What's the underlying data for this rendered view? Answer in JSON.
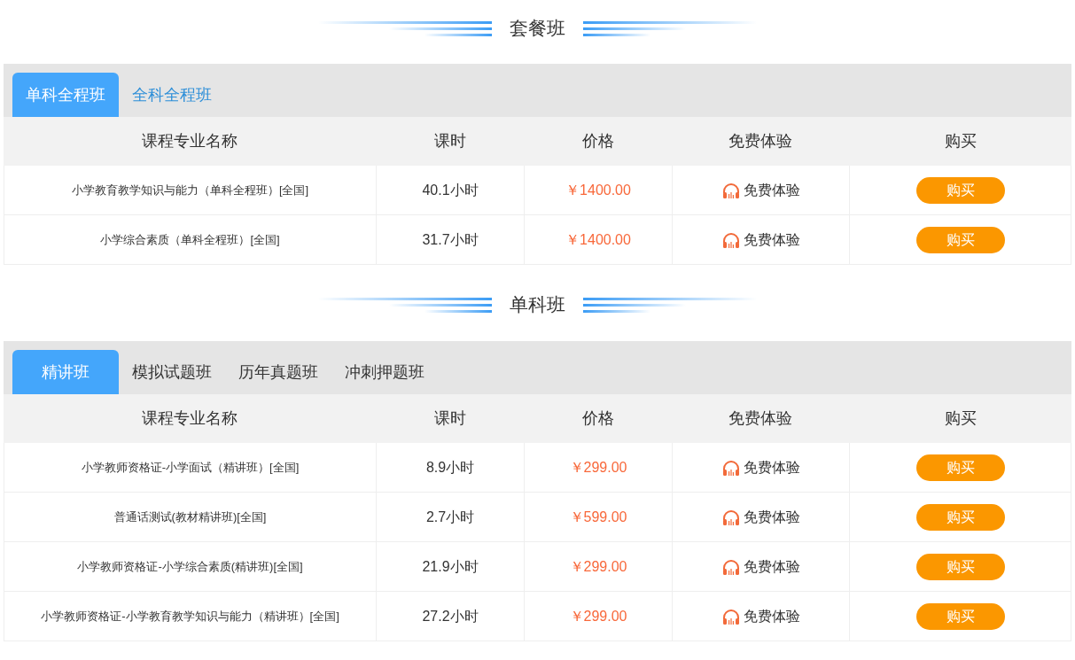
{
  "sections": [
    {
      "title": "套餐班",
      "tabs": [
        {
          "label": "单科全程班",
          "selected": true
        },
        {
          "label": "全科全程班",
          "selected": false,
          "highlighted": true
        }
      ],
      "columns": [
        "课程专业名称",
        "课时",
        "价格",
        "免费体验",
        "购买"
      ],
      "rows": [
        {
          "name": "小学教育教学知识与能力（单科全程班）[全国]",
          "hours": "40.1小时",
          "price": "￥1400.00",
          "trial": "免费体验",
          "buy": "购买"
        },
        {
          "name": "小学综合素质（单科全程班）[全国]",
          "hours": "31.7小时",
          "price": "￥1400.00",
          "trial": "免费体验",
          "buy": "购买"
        }
      ]
    },
    {
      "title": "单科班",
      "tabs": [
        {
          "label": "精讲班",
          "selected": true
        },
        {
          "label": "模拟试题班",
          "selected": false,
          "highlighted": false
        },
        {
          "label": "历年真题班",
          "selected": false,
          "highlighted": false
        },
        {
          "label": "冲刺押题班",
          "selected": false,
          "highlighted": false
        }
      ],
      "columns": [
        "课程专业名称",
        "课时",
        "价格",
        "免费体验",
        "购买"
      ],
      "rows": [
        {
          "name": "小学教师资格证-小学面试（精讲班）[全国]",
          "hours": "8.9小时",
          "price": "￥299.00",
          "trial": "免费体验",
          "buy": "购买"
        },
        {
          "name": "普通话测试(教材精讲班)[全国]",
          "hours": "2.7小时",
          "price": "￥599.00",
          "trial": "免费体验",
          "buy": "购买"
        },
        {
          "name": "小学教师资格证-小学综合素质(精讲班)[全国]",
          "hours": "21.9小时",
          "price": "￥299.00",
          "trial": "免费体验",
          "buy": "购买"
        },
        {
          "name": "小学教师资格证-小学教育教学知识与能力（精讲班）[全国]",
          "hours": "27.2小时",
          "price": "￥299.00",
          "trial": "免费体验",
          "buy": "购买"
        }
      ]
    }
  ]
}
